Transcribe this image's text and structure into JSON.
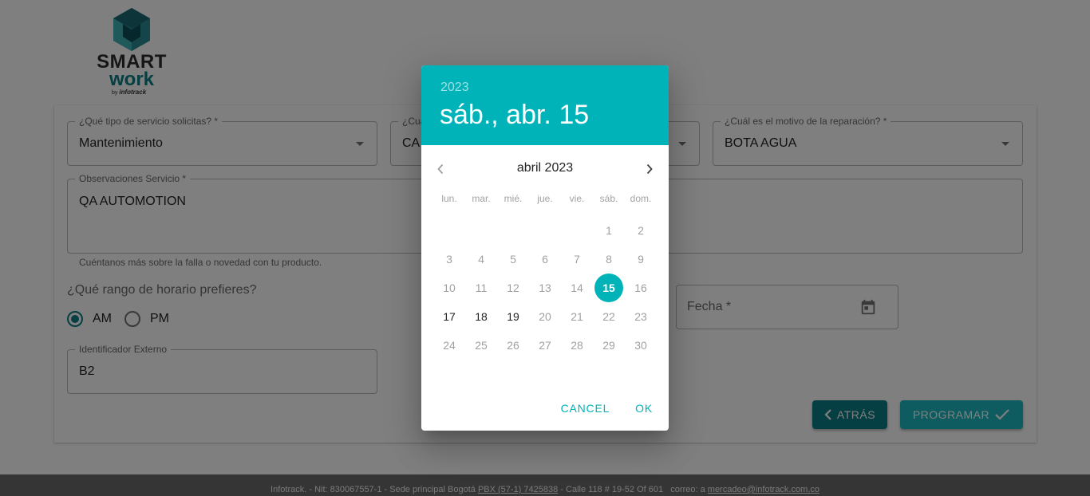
{
  "logo": {
    "word_top": "SMART",
    "word_bottom": "work",
    "by_prefix": "by",
    "by_brand": "infotrack"
  },
  "form": {
    "service_type": {
      "label": "¿Qué tipo de servicio solicitas? *",
      "value": "Mantenimiento"
    },
    "second_field": {
      "label": "¿Cua",
      "value": "CA"
    },
    "reason": {
      "label": "¿Cuál es el motivo de la reparación? *",
      "value": "BOTA AGUA"
    },
    "observations": {
      "label": "Observaciones Servicio *",
      "value": "QA AUTOMOTION",
      "helper": "Cuéntanos más sobre la falla o novedad con tu producto."
    },
    "schedule_question": "¿Qué rango de horario prefieres?",
    "radio_options": [
      {
        "label": "AM",
        "selected": true
      },
      {
        "label": "PM",
        "selected": false
      }
    ],
    "date_field": {
      "placeholder": "Fecha *",
      "icon": "calendar-icon"
    },
    "external_id": {
      "label": "Identificador Externo",
      "value": "B2"
    },
    "back_button": "ATRÁS",
    "schedule_button": "PROGRAMAR"
  },
  "footer": {
    "company": "Infotrack. - Nit: 830067557-1 - Sede principal Bogotá",
    "phone": "PBX (57-1) 7425838",
    "address": "- Calle 118 # 19-52 Of 601",
    "email_prefix": "correo: a",
    "email": "mercadeo@infotrack.com.co"
  },
  "datepicker": {
    "header_year": "2023",
    "header_date": "sáb., abr. 15",
    "month_label": "abril 2023",
    "weekdays": [
      "lun.",
      "mar.",
      "mié.",
      "jue.",
      "vie.",
      "sáb.",
      "dom."
    ],
    "weeks": [
      [
        "",
        "",
        "",
        "",
        "",
        "1",
        "2"
      ],
      [
        "3",
        "4",
        "5",
        "6",
        "7",
        "8",
        "9"
      ],
      [
        "10",
        "11",
        "12",
        "13",
        "14",
        "15",
        "16"
      ],
      [
        "17",
        "18",
        "19",
        "20",
        "21",
        "22",
        "23"
      ],
      [
        "24",
        "25",
        "26",
        "27",
        "28",
        "29",
        "30"
      ]
    ],
    "selected_day": "15",
    "enabled_days": [
      "17",
      "18",
      "19"
    ],
    "cancel_label": "CANCEL",
    "ok_label": "OK"
  },
  "colors": {
    "accent": "#00b3b8",
    "brand_dark": "#0a7f86",
    "program_button": "#1fb9c0",
    "footer_bg": "#6a6a6a"
  }
}
